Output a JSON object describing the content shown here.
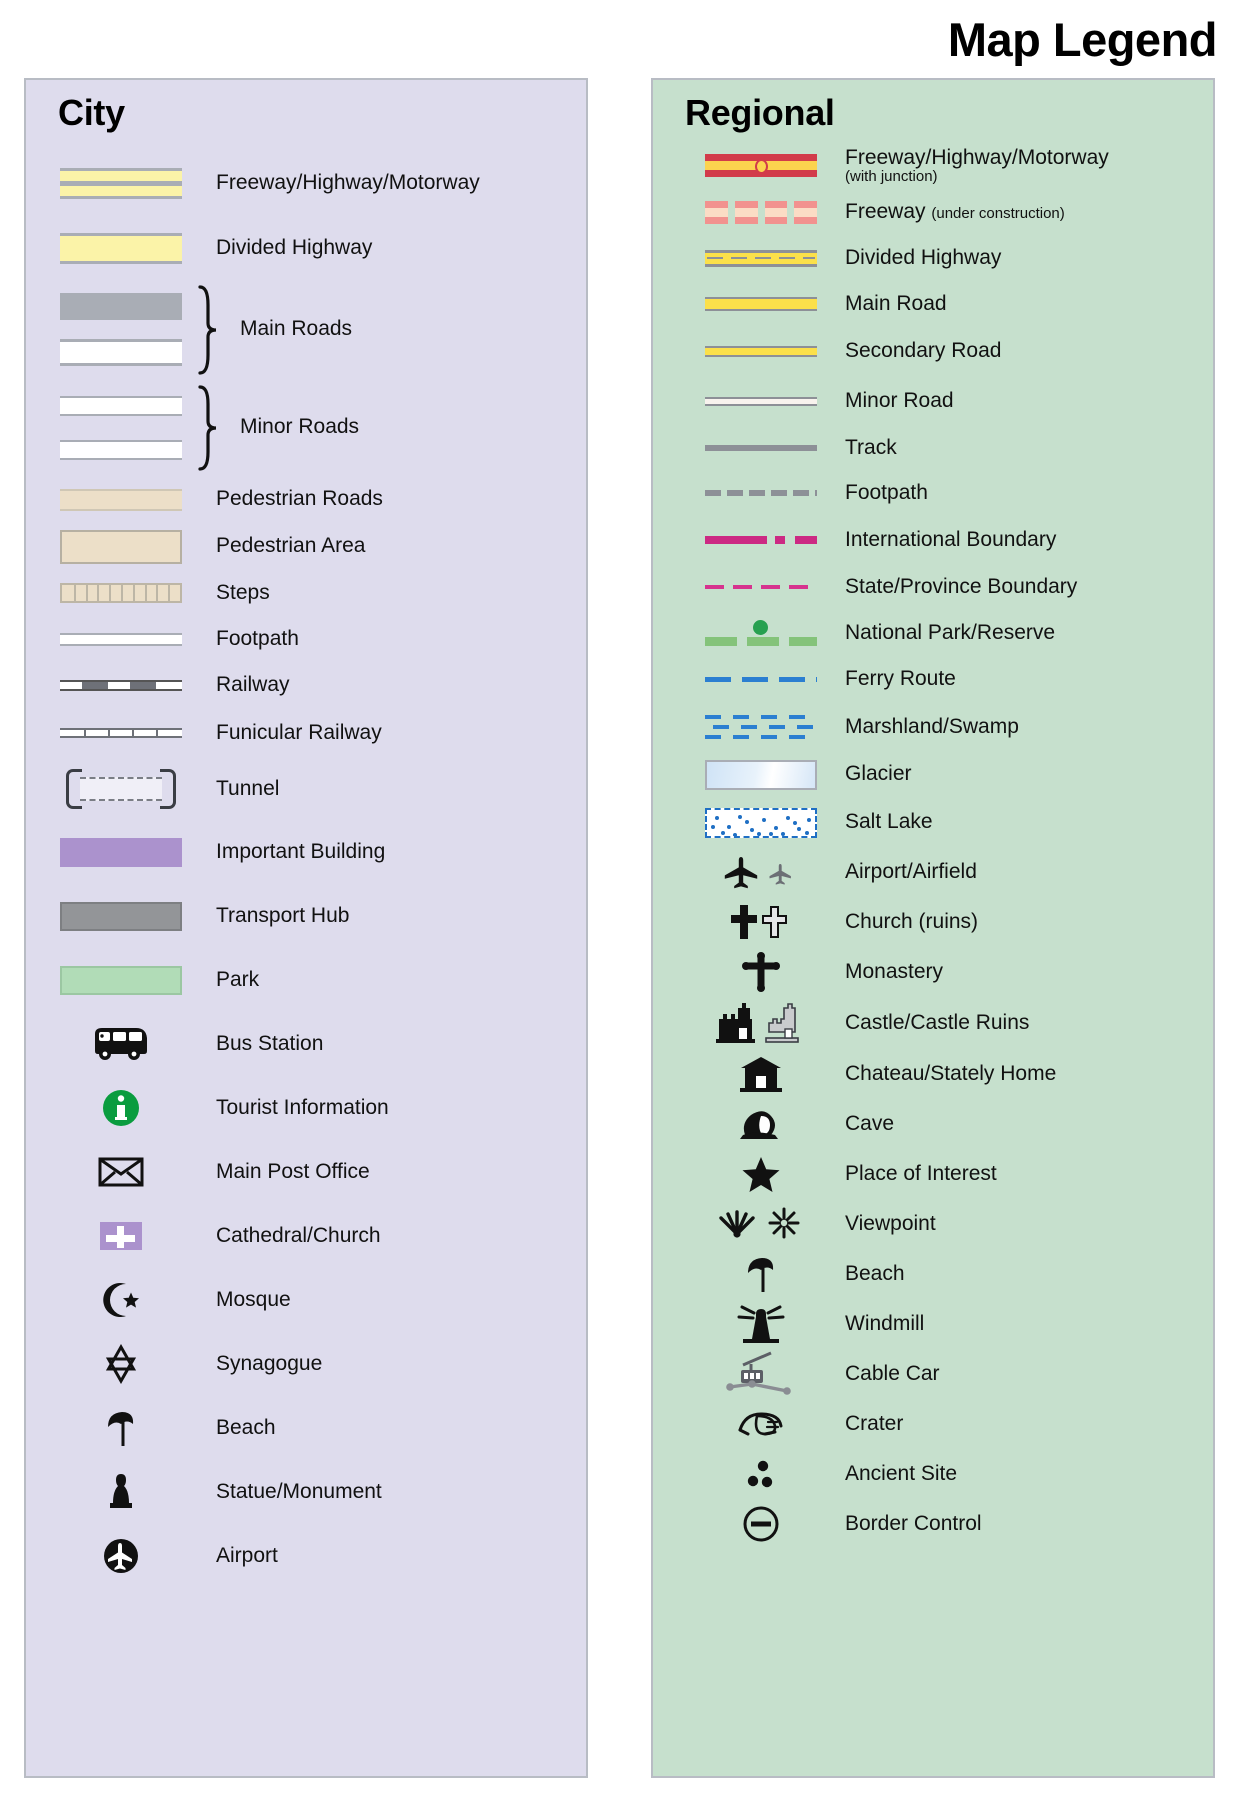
{
  "title": "Map Legend",
  "panels": {
    "city": {
      "heading": "City",
      "bg_color": "#dedced",
      "items": [
        {
          "label": "Freeway/Highway/Motorway",
          "symbol": "city-freeway"
        },
        {
          "label": "Divided Highway",
          "symbol": "city-divided-highway"
        },
        {
          "label": "Main Roads",
          "symbol": "city-main-roads-group"
        },
        {
          "label": "Minor Roads",
          "symbol": "city-minor-roads-group"
        },
        {
          "label": "Pedestrian Roads",
          "symbol": "city-pedestrian-road"
        },
        {
          "label": "Pedestrian Area",
          "symbol": "city-pedestrian-area"
        },
        {
          "label": "Steps",
          "symbol": "city-steps"
        },
        {
          "label": "Footpath",
          "symbol": "city-footpath"
        },
        {
          "label": "Railway",
          "symbol": "city-railway"
        },
        {
          "label": "Funicular Railway",
          "symbol": "city-funicular-railway"
        },
        {
          "label": "Tunnel",
          "symbol": "city-tunnel"
        },
        {
          "label": "Important Building",
          "symbol": "city-important-building"
        },
        {
          "label": "Transport Hub",
          "symbol": "city-transport-hub"
        },
        {
          "label": "Park",
          "symbol": "city-park"
        },
        {
          "label": "Bus Station",
          "symbol": "bus-icon"
        },
        {
          "label": "Tourist Information",
          "symbol": "information-icon"
        },
        {
          "label": "Main Post Office",
          "symbol": "envelope-icon"
        },
        {
          "label": "Cathedral/Church",
          "symbol": "church-cross-badge-icon"
        },
        {
          "label": "Mosque",
          "symbol": "crescent-star-icon"
        },
        {
          "label": "Synagogue",
          "symbol": "star-of-david-icon"
        },
        {
          "label": "Beach",
          "symbol": "beach-umbrella-icon"
        },
        {
          "label": "Statue/Monument",
          "symbol": "statue-icon"
        },
        {
          "label": "Airport",
          "symbol": "airport-circle-icon"
        }
      ],
      "colors": {
        "freeway_fill": "#fbf3a8",
        "road_casing": "#a9adb5",
        "pedestrian_fill": "#ecdfc8",
        "important_building": "#ab92cd",
        "transport_hub": "#939598",
        "park": "#b1dcb7"
      }
    },
    "regional": {
      "heading": "Regional",
      "bg_color": "#c6e0cd",
      "items": [
        {
          "label": "Freeway/Highway/Motorway",
          "sublabel": "(with junction)",
          "symbol": "regional-freeway-junction"
        },
        {
          "label": "Freeway",
          "inline_note": "(under construction)",
          "symbol": "regional-freeway-under-construction"
        },
        {
          "label": "Divided Highway",
          "symbol": "regional-divided-highway"
        },
        {
          "label": "Main Road",
          "symbol": "regional-main-road"
        },
        {
          "label": "Secondary Road",
          "symbol": "regional-secondary-road"
        },
        {
          "label": "Minor Road",
          "symbol": "regional-minor-road"
        },
        {
          "label": "Track",
          "symbol": "regional-track"
        },
        {
          "label": "Footpath",
          "symbol": "regional-footpath"
        },
        {
          "label": "International Boundary",
          "symbol": "regional-international-boundary"
        },
        {
          "label": "State/Province Boundary",
          "symbol": "regional-state-boundary"
        },
        {
          "label": "National Park/Reserve",
          "symbol": "regional-national-park"
        },
        {
          "label": "Ferry Route",
          "symbol": "regional-ferry-route"
        },
        {
          "label": "Marshland/Swamp",
          "symbol": "regional-marshland"
        },
        {
          "label": "Glacier",
          "symbol": "regional-glacier"
        },
        {
          "label": "Salt Lake",
          "symbol": "regional-salt-lake"
        },
        {
          "label": "Airport/Airfield",
          "symbol": "airplane-pair-icon"
        },
        {
          "label": "Church (ruins)",
          "symbol": "cross-pair-icon"
        },
        {
          "label": "Monastery",
          "symbol": "orthodox-cross-icon"
        },
        {
          "label": "Castle/Castle Ruins",
          "symbol": "castle-pair-icon"
        },
        {
          "label": "Chateau/Stately Home",
          "symbol": "chateau-icon"
        },
        {
          "label": "Cave",
          "symbol": "cave-icon"
        },
        {
          "label": "Place of Interest",
          "symbol": "star-icon"
        },
        {
          "label": "Viewpoint",
          "symbol": "viewpoint-pair-icon"
        },
        {
          "label": "Beach",
          "symbol": "beach-umbrella-icon"
        },
        {
          "label": "Windmill",
          "symbol": "windmill-icon"
        },
        {
          "label": "Cable Car",
          "symbol": "cable-car-icon"
        },
        {
          "label": "Crater",
          "symbol": "crater-icon"
        },
        {
          "label": "Ancient Site",
          "symbol": "ancient-site-icon"
        },
        {
          "label": "Border Control",
          "symbol": "border-control-icon"
        }
      ],
      "colors": {
        "freeway_red": "#d23b4a",
        "freeway_yellow": "#fcd34e",
        "under_construction": "#f2928f",
        "road_yellow": "#fbe04a",
        "road_casing": "#8d9097",
        "international_boundary": "#cc2a83",
        "state_boundary": "#d6338e",
        "national_park": "#84c37a",
        "park_dot": "#27a050",
        "water_blue": "#2b7fd1",
        "glacier": "#cfe3f6"
      }
    }
  }
}
